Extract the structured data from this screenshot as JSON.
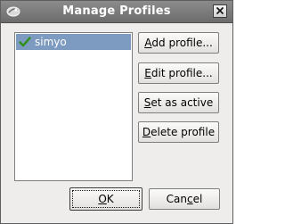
{
  "window": {
    "title": "Manage Profiles",
    "app_icon": "app-icon",
    "close_icon": "close-icon"
  },
  "profiles": [
    {
      "name": "simyo",
      "active": true,
      "selected": true,
      "status_icon": "check-icon"
    }
  ],
  "buttons": {
    "add": {
      "mnemonic": "A",
      "rest": "dd profile..."
    },
    "edit": {
      "mnemonic": "E",
      "rest": "dit profile..."
    },
    "set_active": {
      "mnemonic": "S",
      "rest": "et as active"
    },
    "delete": {
      "mnemonic": "D",
      "rest": "elete profile"
    },
    "ok": {
      "mnemonic": "O",
      "rest": "K"
    },
    "cancel": {
      "pre": "Can",
      "mnemonic": "c",
      "rest": "el"
    }
  },
  "colors": {
    "titlebar": "#7c7c7c",
    "selection": "#7d9ac0",
    "dialog_bg": "#efedeb",
    "check": "#3c9a1e"
  }
}
